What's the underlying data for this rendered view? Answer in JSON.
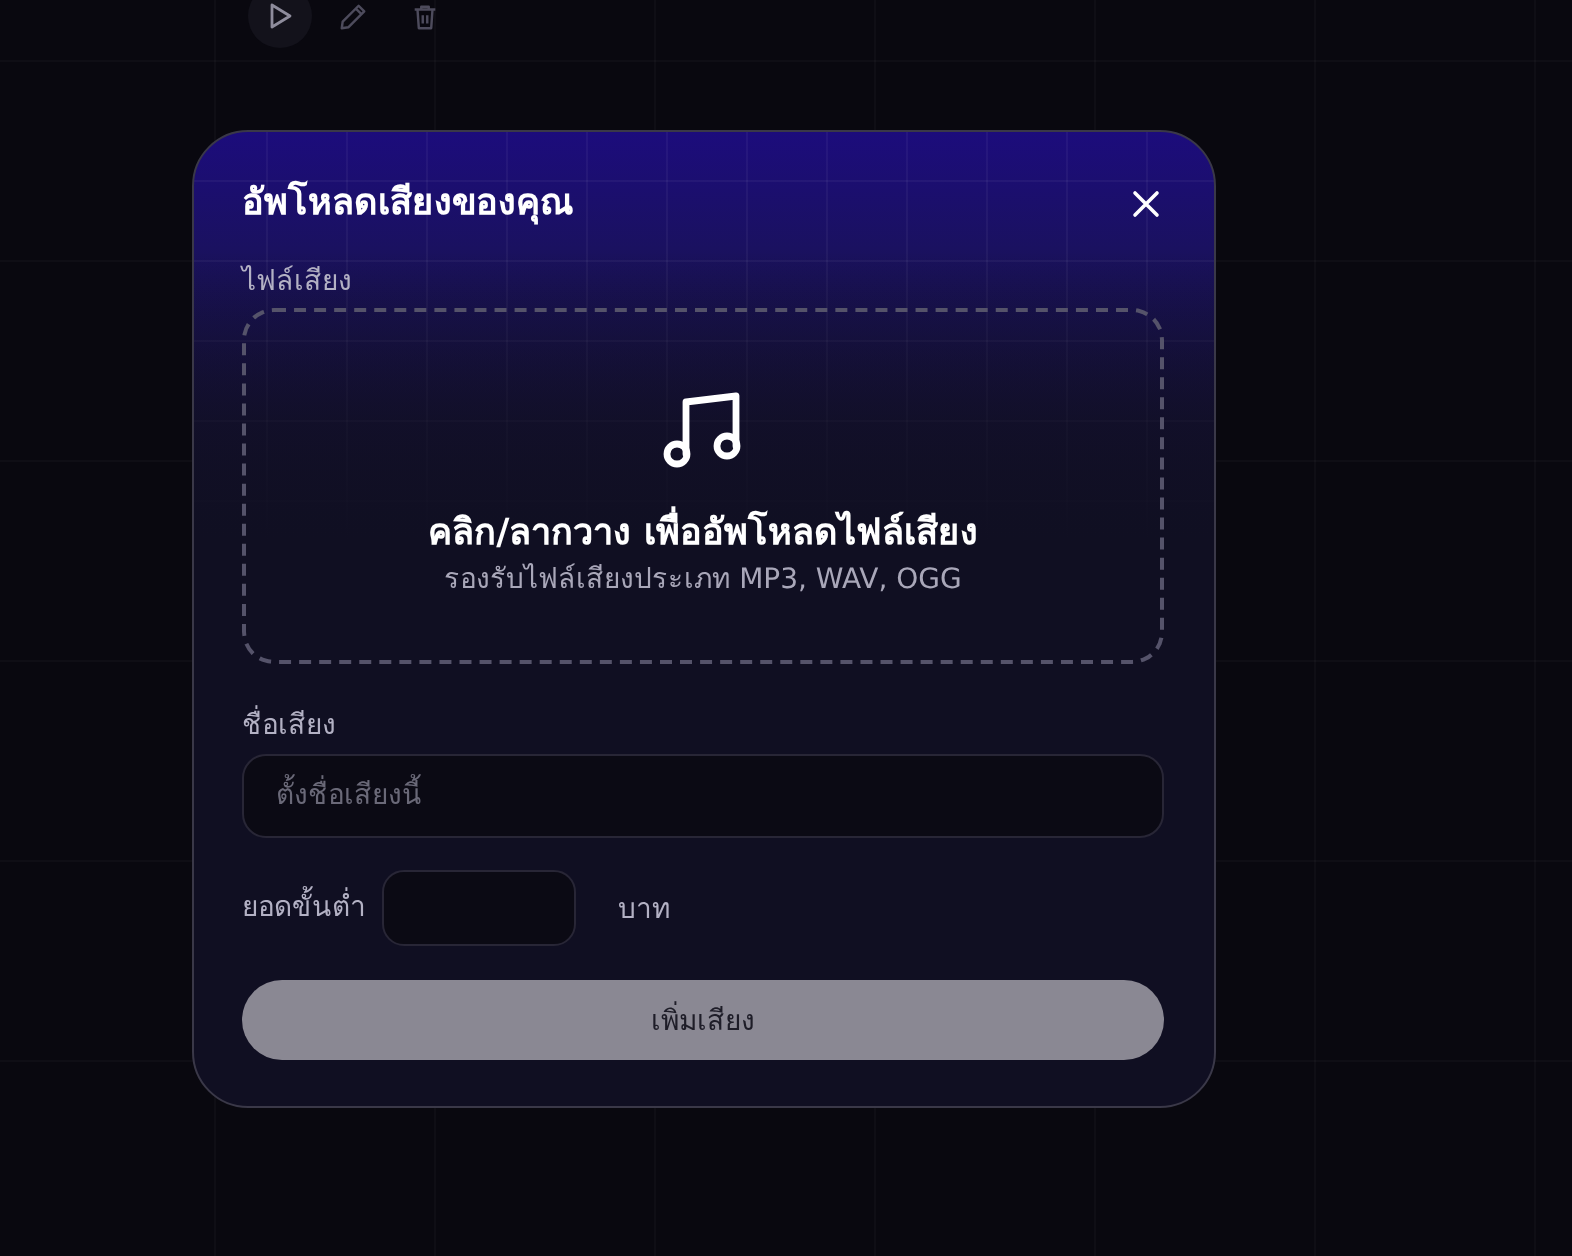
{
  "dialog": {
    "title": "อัพโหลดเสียงของคุณ",
    "file_label": "ไฟล์เสียง",
    "dropzone": {
      "heading": "คลิก/ลากวาง เพื่ออัพโหลดไฟล์เสียง",
      "hint": "รองรับไฟล์เสียงประเภท MP3, WAV, OGG"
    },
    "name_field": {
      "label": "ชื่อเสียง",
      "placeholder": "ตั้งชื่อเสียงนี้"
    },
    "min_amount": {
      "label": "ยอดขั้นต่ำ",
      "unit": "บาท"
    },
    "submit": {
      "label": "เพิ่มเสียง",
      "disabled": true
    }
  }
}
